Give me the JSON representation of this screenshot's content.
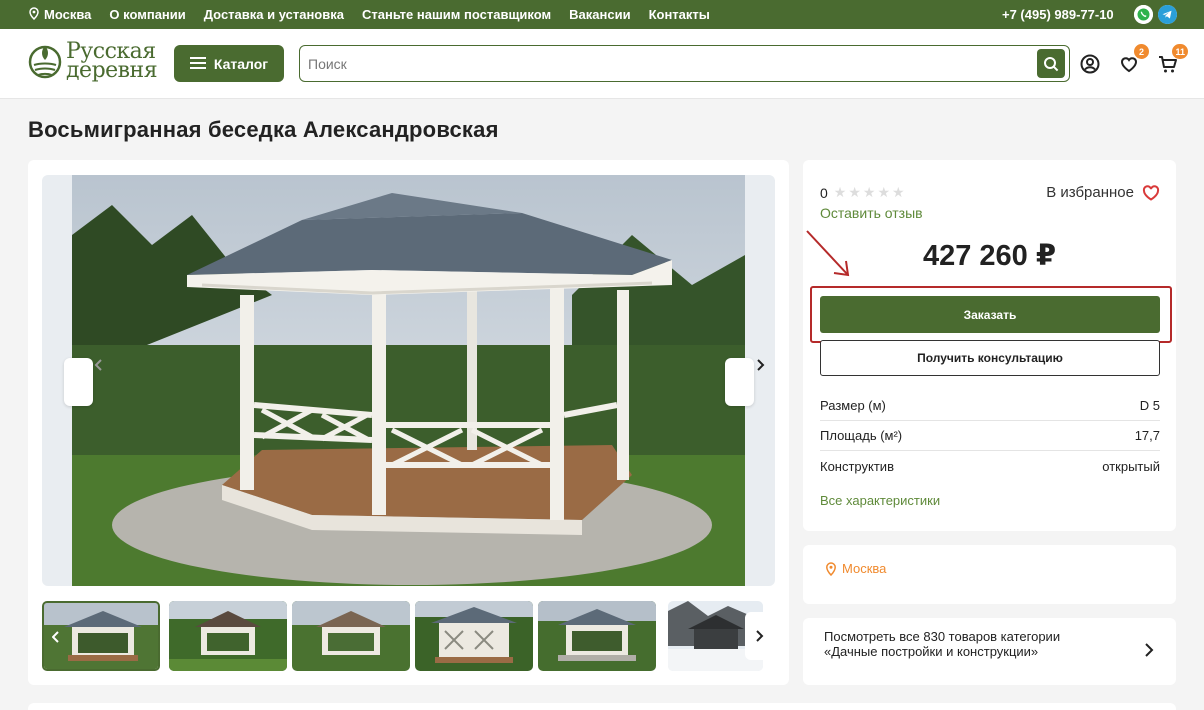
{
  "topbar": {
    "city": "Москва",
    "links": [
      "О компании",
      "Доставка и установка",
      "Станьте нашим поставщиком",
      "Вакансии",
      "Контакты"
    ],
    "phone": "+7 (495) 989-77-10"
  },
  "header": {
    "logo_line1": "Русская",
    "logo_line2": "деревня",
    "catalog_label": "Каталог",
    "search_placeholder": "Поиск",
    "favorites_count": "2",
    "cart_count": "11"
  },
  "product": {
    "title": "Восьмигранная беседка Александровская",
    "rating_value": "0",
    "stars": "★★★★★",
    "review_link": "Оставить отзыв",
    "favorite_label": "В избранное",
    "price": "427 260 ₽",
    "order_label": "Заказать",
    "consult_label": "Получить консультацию",
    "specs": [
      {
        "name": "Размер (м)",
        "value": "D 5"
      },
      {
        "name": "Площадь (м²)",
        "value": "17,7"
      },
      {
        "name": "Конструктив",
        "value": "открытый"
      }
    ],
    "all_specs_link": "Все характеристики"
  },
  "delivery": {
    "city": "Москва"
  },
  "category_link": "Посмотреть все 830 товаров категории «Дачные постройки и конструкции»",
  "colors": {
    "brand_green": "#4a6b30",
    "accent_orange": "#f08a2e",
    "highlight_red": "#b52a2a"
  }
}
